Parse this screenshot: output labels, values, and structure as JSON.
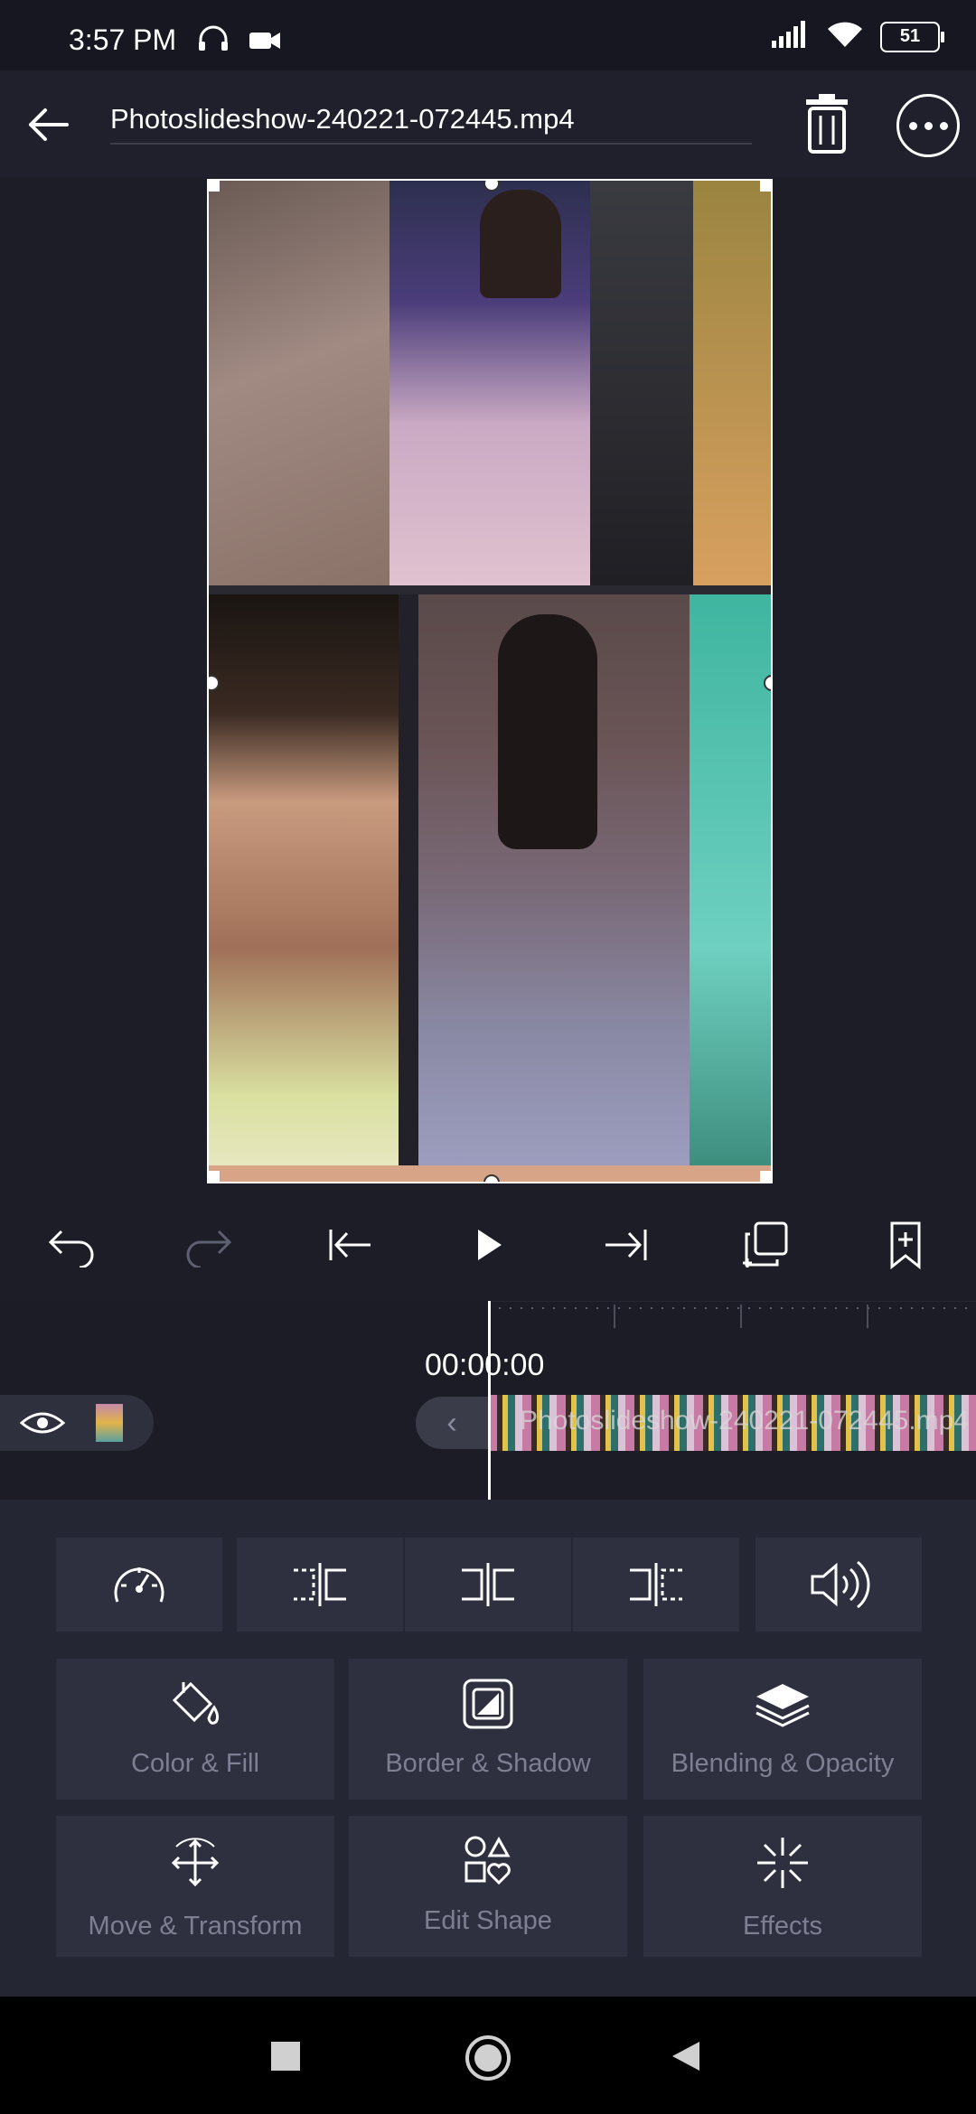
{
  "status_bar": {
    "time": "3:57 PM",
    "battery": "51",
    "icons": [
      "headphones-icon",
      "video-camera-icon",
      "signal-icon",
      "wifi-icon",
      "battery-icon"
    ]
  },
  "app_bar": {
    "title": "Photoslideshow-240221-072445.mp4",
    "icons": [
      "back-arrow-icon",
      "trash-icon",
      "more-icon"
    ]
  },
  "preview": {
    "content": "photo collage",
    "accent": "#ffffff"
  },
  "playback": {
    "icons": [
      "undo-icon",
      "redo-icon",
      "jump-start-icon",
      "play-icon",
      "jump-end-icon",
      "duplicate-icon",
      "bookmark-add-icon"
    ]
  },
  "timeline": {
    "time_code": "00:00:00",
    "clip_name": "Photoslideshow-240221-072445.mp4"
  },
  "tools": {
    "row1_icons": [
      "speed-icon",
      "split-left-icon",
      "split-icon",
      "split-right-icon",
      "volume-icon"
    ],
    "cards": [
      {
        "label": "Color & Fill",
        "icon": "paint-bucket-icon"
      },
      {
        "label": "Border & Shadow",
        "icon": "border-shadow-icon"
      },
      {
        "label": "Blending & Opacity",
        "icon": "layers-icon"
      },
      {
        "label": "Move & Transform",
        "icon": "move-transform-icon"
      },
      {
        "label": "Edit Shape",
        "icon": "shapes-icon"
      },
      {
        "label": "Effects",
        "icon": "sparkle-icon"
      }
    ]
  },
  "nav_bar": {
    "icons": [
      "recents-icon",
      "home-icon",
      "back-icon"
    ]
  }
}
